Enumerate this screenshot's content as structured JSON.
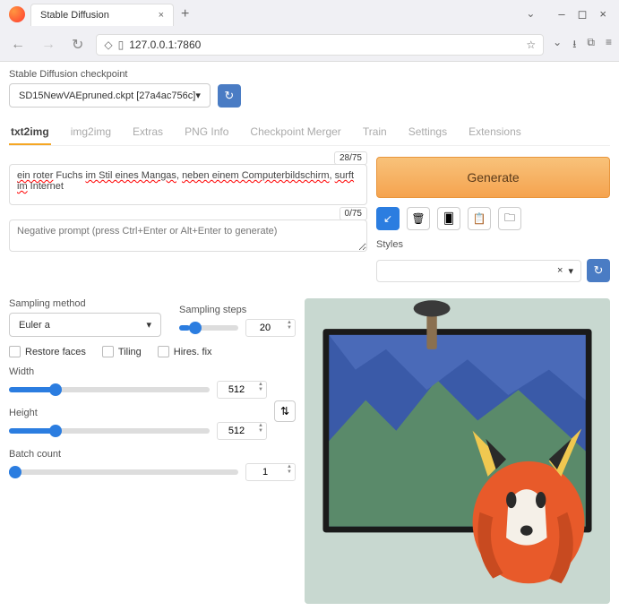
{
  "browser": {
    "tab_title": "Stable Diffusion",
    "url": "127.0.0.1:7860"
  },
  "checkpoint": {
    "label": "Stable Diffusion checkpoint",
    "value": "SD15NewVAEpruned.ckpt [27a4ac756c]"
  },
  "tabs": [
    "txt2img",
    "img2img",
    "Extras",
    "PNG Info",
    "Checkpoint Merger",
    "Train",
    "Settings",
    "Extensions"
  ],
  "active_tab": "txt2img",
  "prompt": {
    "text": "ein roter Fuchs im Stil eines Mangas, neben einem Computerbildschirm, surft im Internet",
    "counter": "28/75"
  },
  "neg_prompt": {
    "placeholder": "Negative prompt (press Ctrl+Enter or Alt+Enter to generate)",
    "counter": "0/75"
  },
  "generate_label": "Generate",
  "styles": {
    "label": "Styles"
  },
  "sampling": {
    "method_label": "Sampling method",
    "method_value": "Euler a",
    "steps_label": "Sampling steps",
    "steps_value": "20"
  },
  "checks": {
    "restore": "Restore faces",
    "tiling": "Tiling",
    "hires": "Hires. fix"
  },
  "width": {
    "label": "Width",
    "value": "512"
  },
  "height": {
    "label": "Height",
    "value": "512"
  },
  "batch_count": {
    "label": "Batch count",
    "value": "1"
  }
}
